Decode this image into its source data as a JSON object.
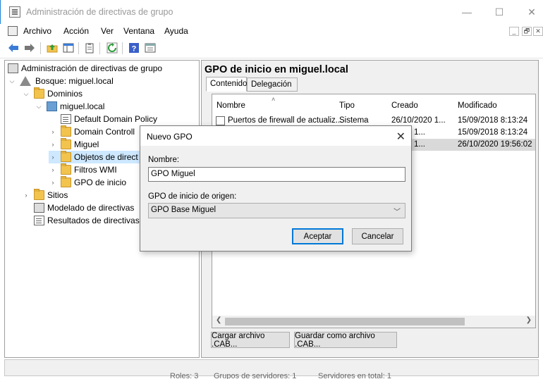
{
  "window": {
    "title": "Administración de directivas de grupo",
    "minimize": "—",
    "maximize": "☐",
    "close": "✕"
  },
  "menu": {
    "items": [
      "Archivo",
      "Acción",
      "Ver",
      "Ventana",
      "Ayuda"
    ],
    "mdi_controls": [
      "_",
      "🗗",
      "✕"
    ]
  },
  "toolbar": {
    "icons": [
      "back-arrow-icon",
      "forward-arrow-icon",
      "up-folder-icon",
      "show-hide-tree-icon",
      "clipboard-icon",
      "refresh-icon",
      "help-icon",
      "properties-icon"
    ]
  },
  "tree": {
    "root": "Administración de directivas de grupo",
    "forest": "Bosque: miguel.local",
    "domains": "Dominios",
    "domain": "miguel.local",
    "default_policy": "Default Domain Policy",
    "domain_controllers": "Domain Controll",
    "ou_miguel": "Miguel",
    "gpo_objects": "Objetos de direct",
    "wmi_filters": "Filtros WMI",
    "starter_gpos": "GPO de inicio",
    "sites": "Sitios",
    "modeling": "Modelado de directivas",
    "results": "Resultados de directivas"
  },
  "right": {
    "title": "GPO de inicio en miguel.local",
    "tabs": [
      "Contenido",
      "Delegación"
    ],
    "columns": [
      "Nombre",
      "Tipo",
      "Creado",
      "Modificado"
    ],
    "rows": [
      {
        "name": "Puertos de firewall de actualiz...",
        "type": "Sistema",
        "created": "26/10/2020 1...",
        "modified": "15/09/2018 8:13:24"
      },
      {
        "name": "",
        "type": "",
        "created": "/2020 1...",
        "modified": "15/09/2018 8:13:24"
      },
      {
        "name": "",
        "type": "",
        "created": "/2020 1...",
        "modified": "26/10/2020 19:56:02"
      }
    ],
    "load_cab": "Cargar archivo .CAB...",
    "save_cab": "Guardar como archivo .CAB..."
  },
  "status": {
    "roles": "Roles: 3",
    "groups": "Grupos de servidores: 1",
    "servers": "Servidores en total: 1"
  },
  "dialog": {
    "title": "Nuevo GPO",
    "name_label": "Nombre:",
    "name_value": "GPO Miguel",
    "source_label": "GPO de inicio de origen:",
    "source_value": "GPO Base Miguel",
    "ok": "Aceptar",
    "cancel": "Cancelar"
  }
}
